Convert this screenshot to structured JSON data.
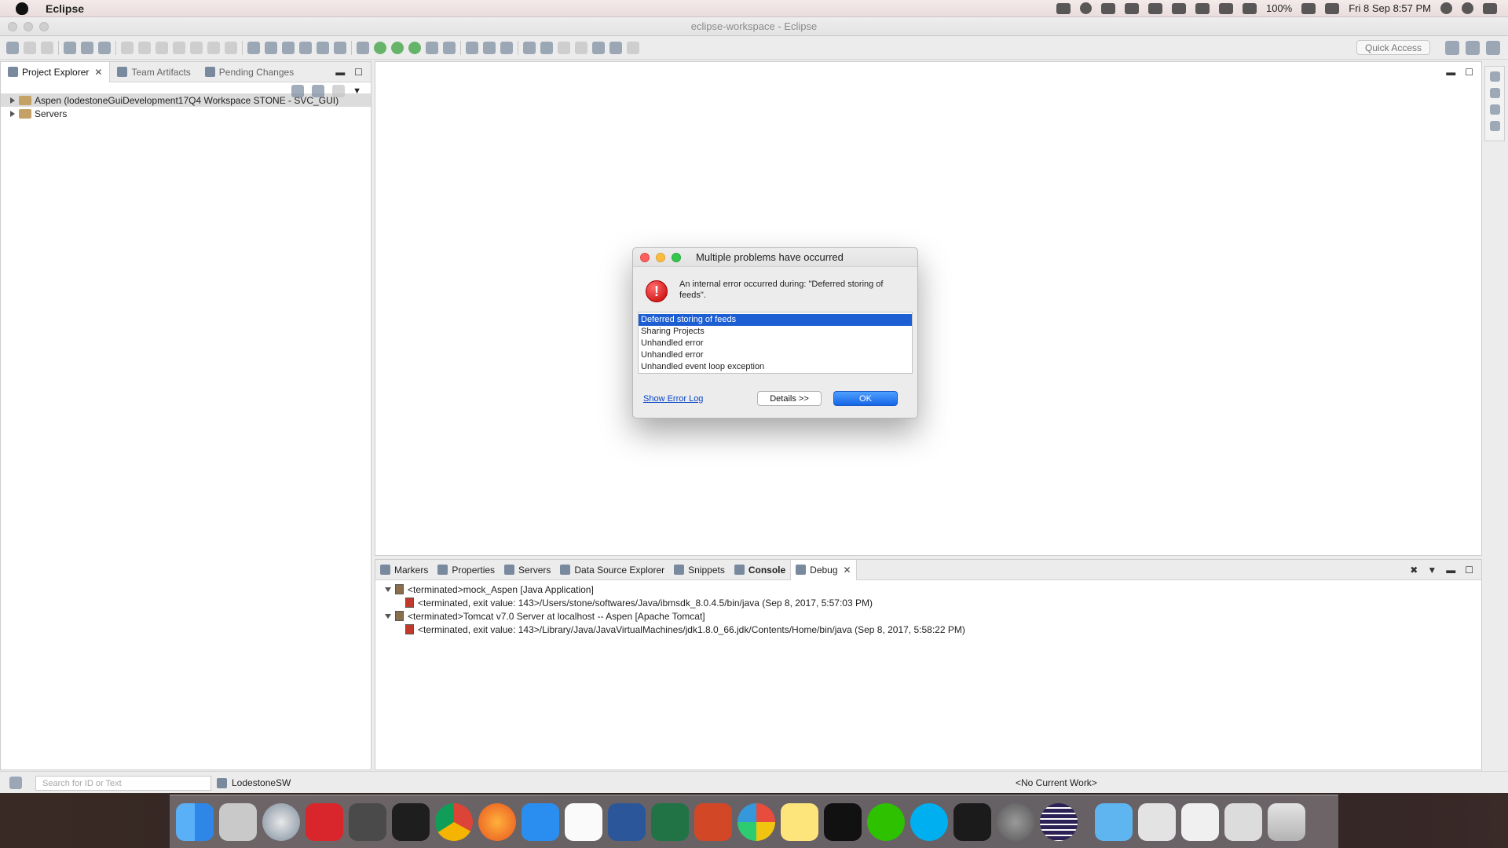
{
  "menubar": {
    "app_name": "Eclipse",
    "battery": "100%",
    "datetime": "Fri 8 Sep  8:57 PM"
  },
  "window": {
    "title": "eclipse-workspace - Eclipse"
  },
  "toolbar": {
    "quick_access_placeholder": "Quick Access"
  },
  "left_panel": {
    "tabs": [
      {
        "label": "Project Explorer",
        "active": true
      },
      {
        "label": "Team Artifacts",
        "active": false
      },
      {
        "label": "Pending Changes",
        "active": false
      }
    ],
    "tree": [
      {
        "label": "Aspen (lodestoneGuiDevelopment17Q4 Workspace STONE - SVC_GUI)",
        "selected": true
      },
      {
        "label": "Servers",
        "selected": false
      }
    ]
  },
  "bottom_panel": {
    "tabs": [
      {
        "label": "Markers"
      },
      {
        "label": "Properties"
      },
      {
        "label": "Servers"
      },
      {
        "label": "Data Source Explorer"
      },
      {
        "label": "Snippets"
      },
      {
        "label": "Console"
      },
      {
        "label": "Debug"
      }
    ],
    "debug_rows": [
      {
        "label": "<terminated>mock_Aspen [Java Application]",
        "level": 0
      },
      {
        "label": "<terminated, exit value: 143>/Users/stone/softwares/Java/ibmsdk_8.0.4.5/bin/java (Sep 8, 2017, 5:57:03 PM)",
        "level": 1
      },
      {
        "label": "<terminated>Tomcat v7.0 Server at localhost -- Aspen [Apache Tomcat]",
        "level": 0
      },
      {
        "label": "<terminated, exit value: 143>/Library/Java/JavaVirtualMachines/jdk1.8.0_66.jdk/Contents/Home/bin/java (Sep 8, 2017, 5:58:22 PM)",
        "level": 1
      }
    ]
  },
  "statusbar": {
    "search_placeholder": "Search for ID or Text",
    "repo_label": "LodestoneSW",
    "current_work": "<No Current Work>"
  },
  "dialog": {
    "title": "Multiple problems have occurred",
    "message": "An internal error occurred during: \"Deferred storing of feeds\".",
    "problems": [
      "Deferred storing of feeds",
      "Sharing Projects",
      "Unhandled error",
      "Unhandled error",
      "Unhandled event loop exception"
    ],
    "show_log_label": "Show Error Log",
    "details_label": "Details >>",
    "ok_label": "OK"
  },
  "colors": {
    "selection_blue": "#1d5fd3",
    "ok_button_blue": "#1566e6",
    "error_red": "#c40000"
  }
}
